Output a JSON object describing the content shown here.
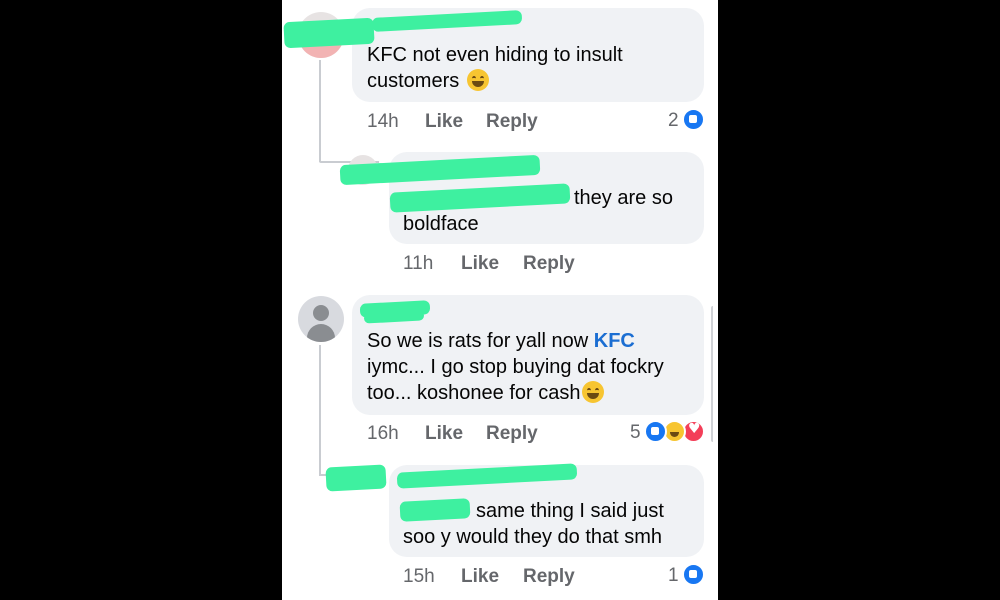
{
  "comments": [
    {
      "text_lines": [
        "KFC not even hiding to insult",
        "customers"
      ],
      "emoji": "grinning-sweat-emoji",
      "time": "14h",
      "like_label": "Like",
      "reply_label": "Reply",
      "reaction_count": "2",
      "reactions": [
        "like"
      ]
    },
    {
      "text_lines": [
        "they are so",
        "boldface"
      ],
      "time": "11h",
      "like_label": "Like",
      "reply_label": "Reply"
    },
    {
      "text_line1_prefix": "So we is rats for yall now ",
      "mention": "KFC",
      "text_lines_rest": [
        "iymc... I go stop buying dat fockry",
        "too... koshonee for cash"
      ],
      "emoji": "huffing-emoji",
      "time": "16h",
      "like_label": "Like",
      "reply_label": "Reply",
      "reaction_count": "5",
      "reactions": [
        "like",
        "haha",
        "love"
      ]
    },
    {
      "text_lines": [
        "same thing I said just",
        "soo y would they do that smh"
      ],
      "time": "15h",
      "like_label": "Like",
      "reply_label": "Reply",
      "reaction_count": "1",
      "reactions": [
        "like"
      ]
    }
  ],
  "colors": {
    "background": "#000000",
    "bubble": "#f0f2f5",
    "mention": "#1b6ed2",
    "meta": "#65676b",
    "redaction": "#3ef0a0",
    "like_reaction": "#1877f2"
  }
}
